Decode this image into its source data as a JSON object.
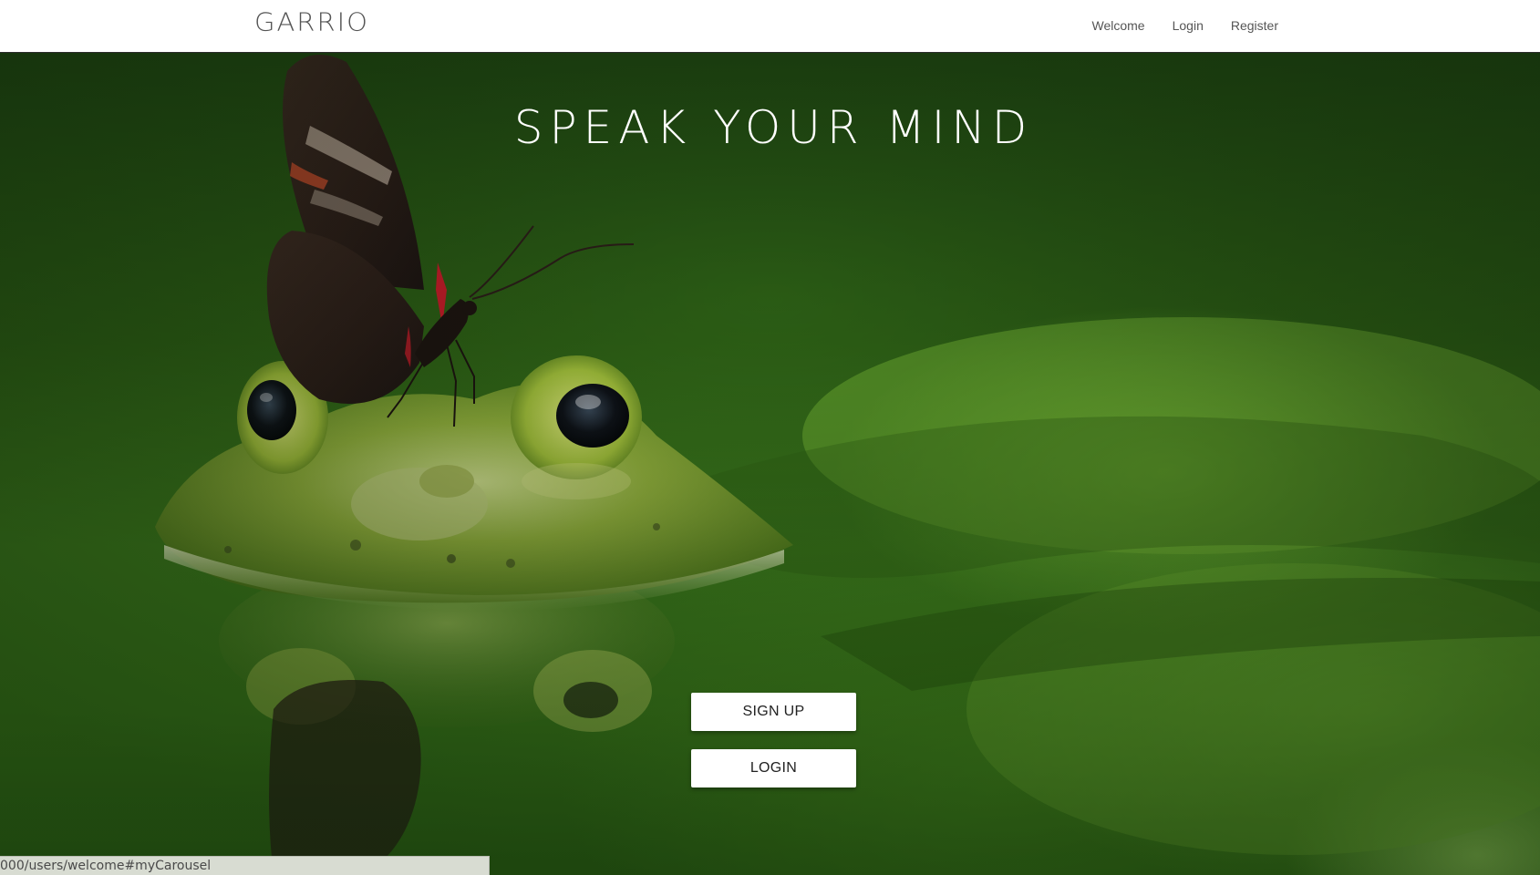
{
  "navbar": {
    "brand": "GARRIO",
    "links": [
      {
        "label": "Welcome"
      },
      {
        "label": "Login"
      },
      {
        "label": "Register"
      }
    ]
  },
  "hero": {
    "title": "SPEAK YOUR MIND",
    "background_image": "frog-with-butterfly-photo",
    "buttons": {
      "signup_label": "SIGN UP",
      "login_label": "LOGIN"
    }
  },
  "status_bar": {
    "url": "000/users/welcome#myCarousel"
  },
  "colors": {
    "navbar_bg": "#ffffff",
    "nav_text": "#555555",
    "hero_green": "#3c7a1d",
    "button_bg": "#ffffff",
    "title_text": "#ffffff"
  }
}
